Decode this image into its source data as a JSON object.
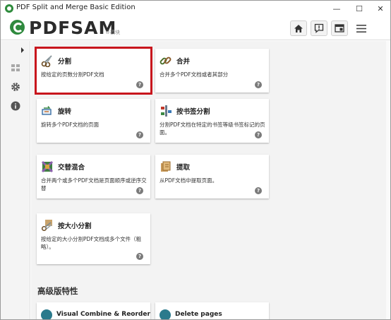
{
  "window": {
    "title": "PDF Split and Merge Basic Edition",
    "minimize": "—",
    "maximize": "☐",
    "close": "✕"
  },
  "header": {
    "logo": "PDFSAM",
    "logo_sub": "®模块"
  },
  "modules": [
    {
      "title": "分割",
      "desc": "按给定的页数分割PDF文档",
      "help": "?",
      "icon": "scissors-icon",
      "selected": true
    },
    {
      "title": "合并",
      "desc": "合并多个PDF文档或者其部分",
      "help": "?",
      "icon": "merge-icon"
    },
    {
      "title": "旋转",
      "desc": "旋转多个PDF文档的页面",
      "help": "?",
      "icon": "rotate-icon"
    },
    {
      "title": "按书签分割",
      "desc": "分割PDF文档在特定的书签等级书签标记的页面。",
      "help": "?",
      "icon": "bookmark-split-icon"
    },
    {
      "title": "交替混合",
      "desc": "合并两个或多个PDF文档是页面顺序或逆序交替",
      "help": "?",
      "icon": "alternate-mix-icon"
    },
    {
      "title": "提取",
      "desc": "从PDF文档中提取页面。",
      "help": "?",
      "icon": "extract-icon"
    },
    {
      "title": "按大小分割",
      "desc": "按给定的大小分割PDF文档成多个文件（粗略）。",
      "help": "?",
      "icon": "size-split-icon"
    }
  ],
  "advanced": {
    "title": "高级版特性",
    "items": [
      {
        "title": "Visual Combine & Reorder"
      },
      {
        "title": "Delete pages"
      }
    ]
  },
  "colors": {
    "accent_green": "#2f8a3e",
    "selected_border": "#c8161d",
    "background": "#f3f3f3"
  }
}
